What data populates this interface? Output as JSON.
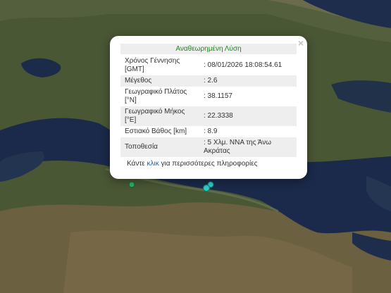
{
  "popup": {
    "title": "Αναθεωρημένη Λύση",
    "close_symbol": "×",
    "rows": [
      {
        "label": "Χρόνος Γέννησης [GMT]",
        "value": ": 08/01/2026 18:08:54.61"
      },
      {
        "label": "Μέγεθος",
        "value": ": 2.6"
      },
      {
        "label": "Γεωγραφικό Πλάτος [°N]",
        "value": ": 38.1157"
      },
      {
        "label": "Γεωγραφικό Μήκος [°E]",
        "value": ": 22.3338"
      },
      {
        "label": "Εστιακό Βάθος [km]",
        "value": ": 8.9"
      },
      {
        "label": "Τοποθεσία",
        "value": ": 5 Χλμ. ΝΝΑ της Άνω Ακράτας"
      }
    ],
    "more_prefix": "Κάντε ",
    "more_link": "κλικ",
    "more_suffix": " για περισσότερες πληροφορίες"
  },
  "colors": {
    "title_green": "#1a8a1a",
    "link_blue": "#1a5fb4",
    "marker_green": "#2db36a",
    "marker_cyan": "#2fd0c8",
    "sea": "#1b2a4a",
    "land": "#4b5a36"
  },
  "icons": [
    "close-icon",
    "earthquake-marker"
  ]
}
